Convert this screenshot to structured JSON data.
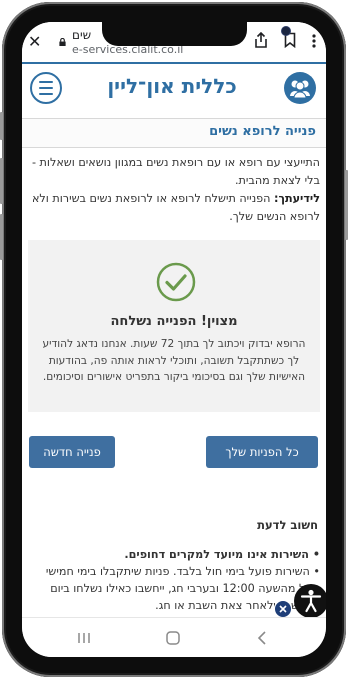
{
  "browser": {
    "tab_title": "שים",
    "url": "e-services.clalit.co.il"
  },
  "site": {
    "title": "כללית און־ליין",
    "accent_color": "#2f6fa3"
  },
  "page": {
    "title": "פנייה לרופא נשים",
    "intro_text": "התייעצי עם רופא או עם רופאת נשים במגוון נושאים ושאלות - בלי לצאת מהבית.",
    "note_label": "לידיעתך:",
    "note_text": "הפנייה תישלח לרופא או לרופאת נשים בשירות ולא לרופא הנשים שלך."
  },
  "success": {
    "icon": "check-circle-icon",
    "title": "מצוין! הפנייה נשלחה",
    "text": "הרופא יבדוק ויכתוב לך בתוך 72 שעות. אנחנו נדאג להודיע לך כשתתקבל תשובה, ותוכלי לראות אותה פה, בהודעות האישיות שלך וגם בסיכומי ביקור בתפריט אישורים וסיכומים."
  },
  "buttons": {
    "my_requests": "כל הפניות שלך",
    "new_request": "פנייה חדשה"
  },
  "info": {
    "title": "חשוב לדעת",
    "bullet1": "• השירות אינו מיועד למקרים דחופים.",
    "bullet2": "• השירות פועל בימי חול בלבד. פניות שיתקבלו בימי חמישי החל מהשעה 12:00 ובערבי חג, ייחשבו כאילו נשלחו ביום הראשון שלאחר צאת השבת או חג."
  }
}
